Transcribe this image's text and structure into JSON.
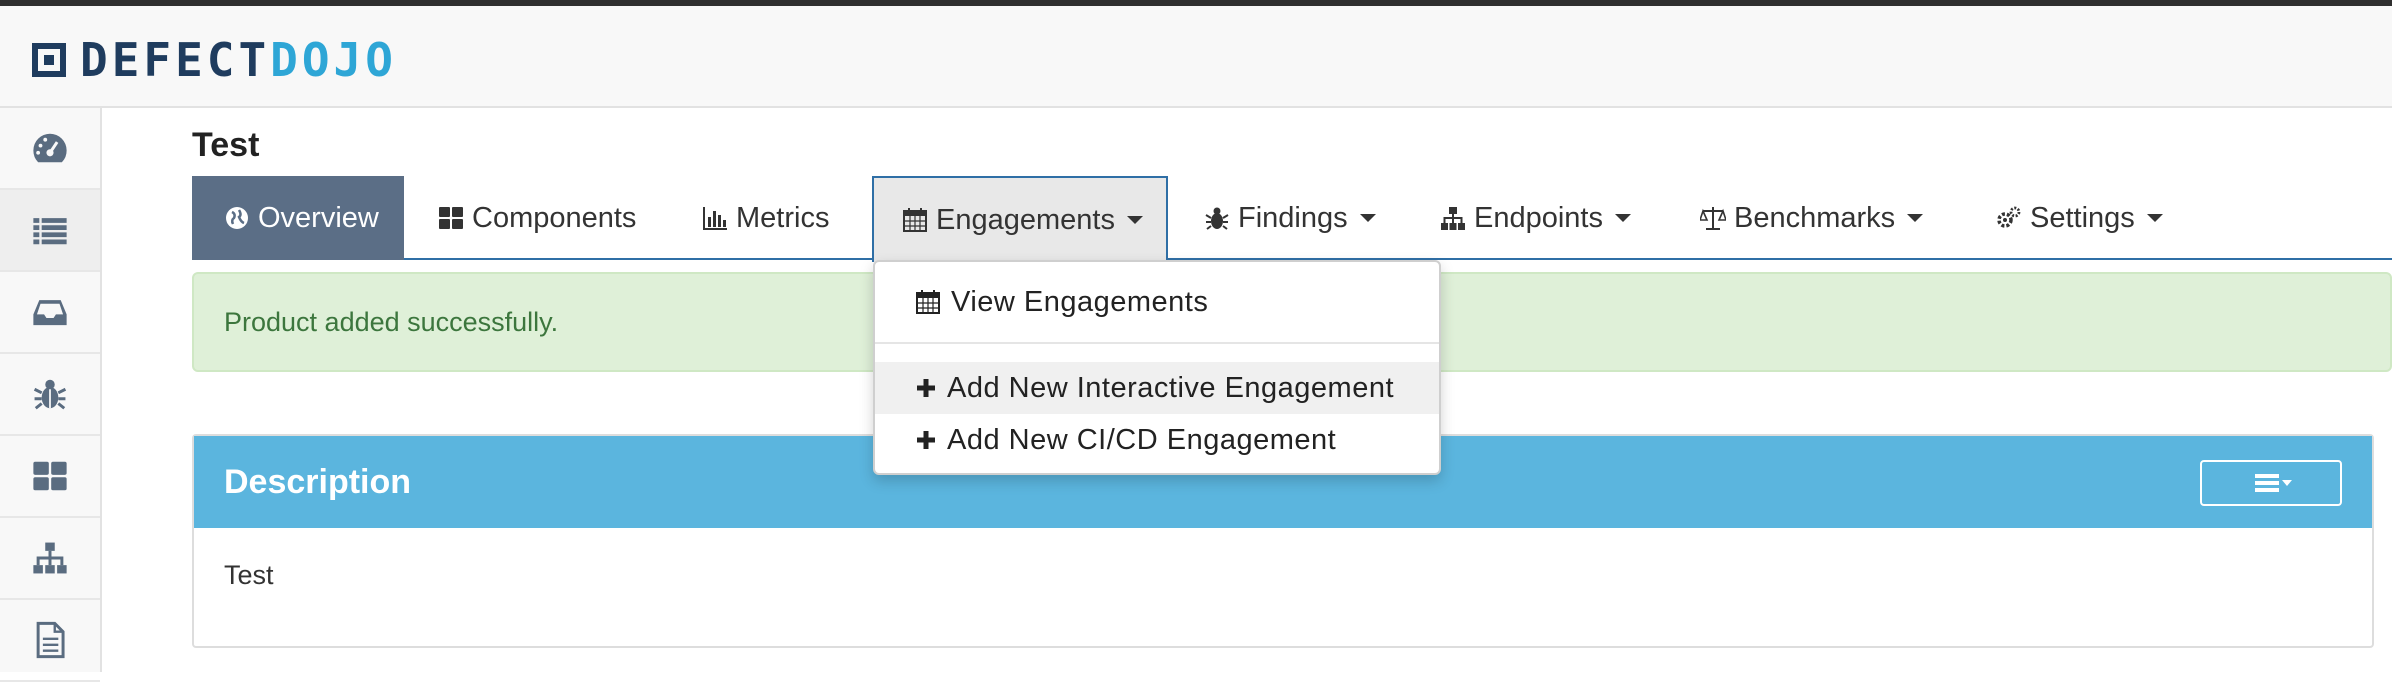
{
  "brand": {
    "part1": "DEFECT",
    "part2": "DOJO"
  },
  "sidebar": {
    "items": [
      {
        "icon": "dashboard-icon"
      },
      {
        "icon": "list-icon"
      },
      {
        "icon": "inbox-icon"
      },
      {
        "icon": "bug-icon"
      },
      {
        "icon": "grid-icon"
      },
      {
        "icon": "sitemap-icon"
      },
      {
        "icon": "document-icon"
      }
    ]
  },
  "page": {
    "title": "Test"
  },
  "nav": {
    "tabs": [
      {
        "label": "Overview",
        "icon": "globe-icon"
      },
      {
        "label": "Components",
        "icon": "components-icon"
      },
      {
        "label": "Metrics",
        "icon": "bar-chart-icon"
      },
      {
        "label": "Engagements",
        "icon": "calendar-icon"
      },
      {
        "label": "Findings",
        "icon": "bug-icon"
      },
      {
        "label": "Endpoints",
        "icon": "sitemap-icon"
      },
      {
        "label": "Benchmarks",
        "icon": "balance-icon"
      },
      {
        "label": "Settings",
        "icon": "gears-icon"
      }
    ]
  },
  "alert": {
    "message": "Product added successfully."
  },
  "panel": {
    "title": "Description",
    "body": "Test"
  },
  "dropdown": {
    "items": [
      {
        "label": "View Engagements",
        "icon": "calendar-icon"
      },
      {
        "label": "Add New Interactive Engagement",
        "icon": "plus-icon"
      },
      {
        "label": "Add New CI/CD Engagement",
        "icon": "plus-icon"
      }
    ]
  },
  "colors": {
    "nav_active": "#5b6e86",
    "panel_header": "#5bb5de",
    "alert_bg": "#dff0d8",
    "alert_text": "#3c763d",
    "brand_dark": "#1f3c5e",
    "brand_light": "#2ea6d6"
  }
}
